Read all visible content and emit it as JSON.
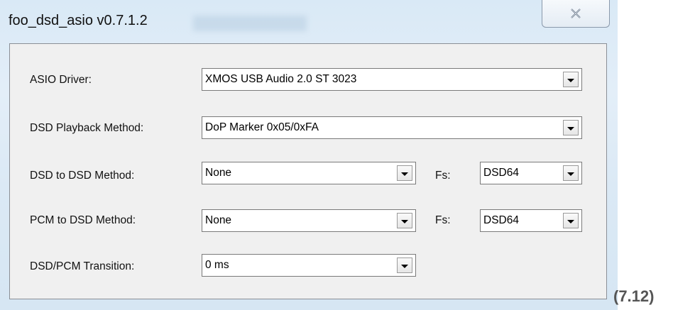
{
  "window": {
    "title": "foo_dsd_asio v0.7.1.2"
  },
  "caption": "(7.12)",
  "rows": [
    {
      "label": "ASIO Driver:",
      "value": "XMOS USB Audio 2.0 ST 3023"
    },
    {
      "label": "DSD Playback Method:",
      "value": "DoP Marker 0x05/0xFA"
    },
    {
      "label": "DSD to DSD Method:",
      "value": "None",
      "fs_label": "Fs:",
      "fs_value": "DSD64"
    },
    {
      "label": "PCM to DSD Method:",
      "value": "None",
      "fs_label": "Fs:",
      "fs_value": "DSD64"
    },
    {
      "label": "DSD/PCM Transition:",
      "value": "0 ms"
    }
  ]
}
